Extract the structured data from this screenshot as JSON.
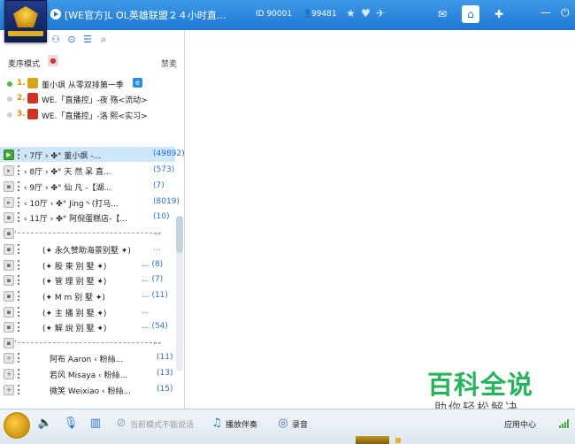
{
  "window": {
    "title": "[WE官方]L OL英雄联盟２４小时直...",
    "room_id": "ID 90001",
    "user_icon": "user-icon",
    "online_count": "99481",
    "accent_color": "#1f78d2"
  },
  "title_icons": [
    "star-icon",
    "heart-icon",
    "plane-icon",
    "message-icon",
    "home-icon",
    "gamepad-icon",
    "minimize-icon",
    "power-icon"
  ],
  "toolbar": {
    "icons": [
      "people-icon",
      "location-icon",
      "list-icon",
      "search-icon"
    ]
  },
  "mic_panel": {
    "mode_label": "麦序模式",
    "ban_label": "禁麦",
    "queue": [
      {
        "num": "1.",
        "name": "董小飒 从零双排第一季",
        "active": true
      },
      {
        "num": "2.",
        "name": "WE.「直播控」-夜  殇<流动>",
        "active": false
      },
      {
        "num": "3.",
        "name": "WE.「直播控」-洛  熙<实习>",
        "active": false
      }
    ]
  },
  "channels": [
    {
      "name": "‹ 7厅 ›   ✤° 董小飒  -...",
      "count": "(49892)",
      "state": "play",
      "selected": true
    },
    {
      "name": "‹ 8厅 ›   ✤° 天 然 呆 直...",
      "count": "(573)",
      "state": "arrow"
    },
    {
      "name": "‹ 9厅 ›   ✤° 仙  凡  -【湖...",
      "count": "(7)",
      "state": "lock"
    },
    {
      "name": "‹ 10厅 ›  ✤° Jing丶(打马...",
      "count": "(8019)",
      "state": "arrow"
    },
    {
      "name": "‹ 11厅 ›  ✤° 阿倪蛋糕店-【...",
      "count": "(10)",
      "state": "lock"
    },
    {
      "name": "·",
      "count": "...",
      "state": "lock",
      "separator": true
    },
    {
      "name": "(✦ 永久赞助海景别墅 ✦)",
      "count": "...",
      "state": "lock",
      "sub": true
    },
    {
      "name": "(✦ 股  東  別  墅 ✦)",
      "count": "... (8)",
      "state": "lock",
      "sub": true
    },
    {
      "name": "(✦ 管  理  别  墅 ✦)",
      "count": "... (7)",
      "state": "lock",
      "sub": true
    },
    {
      "name": "(✦ M  m  别  墅 ✦)",
      "count": "... (11)",
      "state": "lock",
      "sub": true
    },
    {
      "name": "(✦ 主  播  别  墅 ✦)",
      "count": "...",
      "state": "lock",
      "sub": true
    },
    {
      "name": "(✦ 解  說  別  墅 ✦)",
      "count": "... (54)",
      "state": "lock",
      "sub": true
    },
    {
      "name": "·",
      "count": "...",
      "state": "lock",
      "separator": true
    },
    {
      "name": "阿布 Aaron     ‹  粉絲...",
      "count": "(11)",
      "state": "plus",
      "member": true
    },
    {
      "name": "若风 Misaya    ‹  粉絲...",
      "count": "(13)",
      "state": "plus",
      "member": true
    },
    {
      "name": "微笑 Weixiao   ‹  粉絲...",
      "count": "(15)",
      "state": "plus",
      "member": true
    }
  ],
  "bottom_bar": {
    "icons": [
      "avatar-icon",
      "speaker-icon",
      "mic-icon",
      "equalizer-icon"
    ],
    "mode_notice": "当前模式不能说话",
    "play_music_label": "播放伴奏",
    "record_label": "录音",
    "app_center_label": "应用中心"
  },
  "watermark": {
    "title": "百科全说",
    "subtitle": "助你轻松解决"
  }
}
